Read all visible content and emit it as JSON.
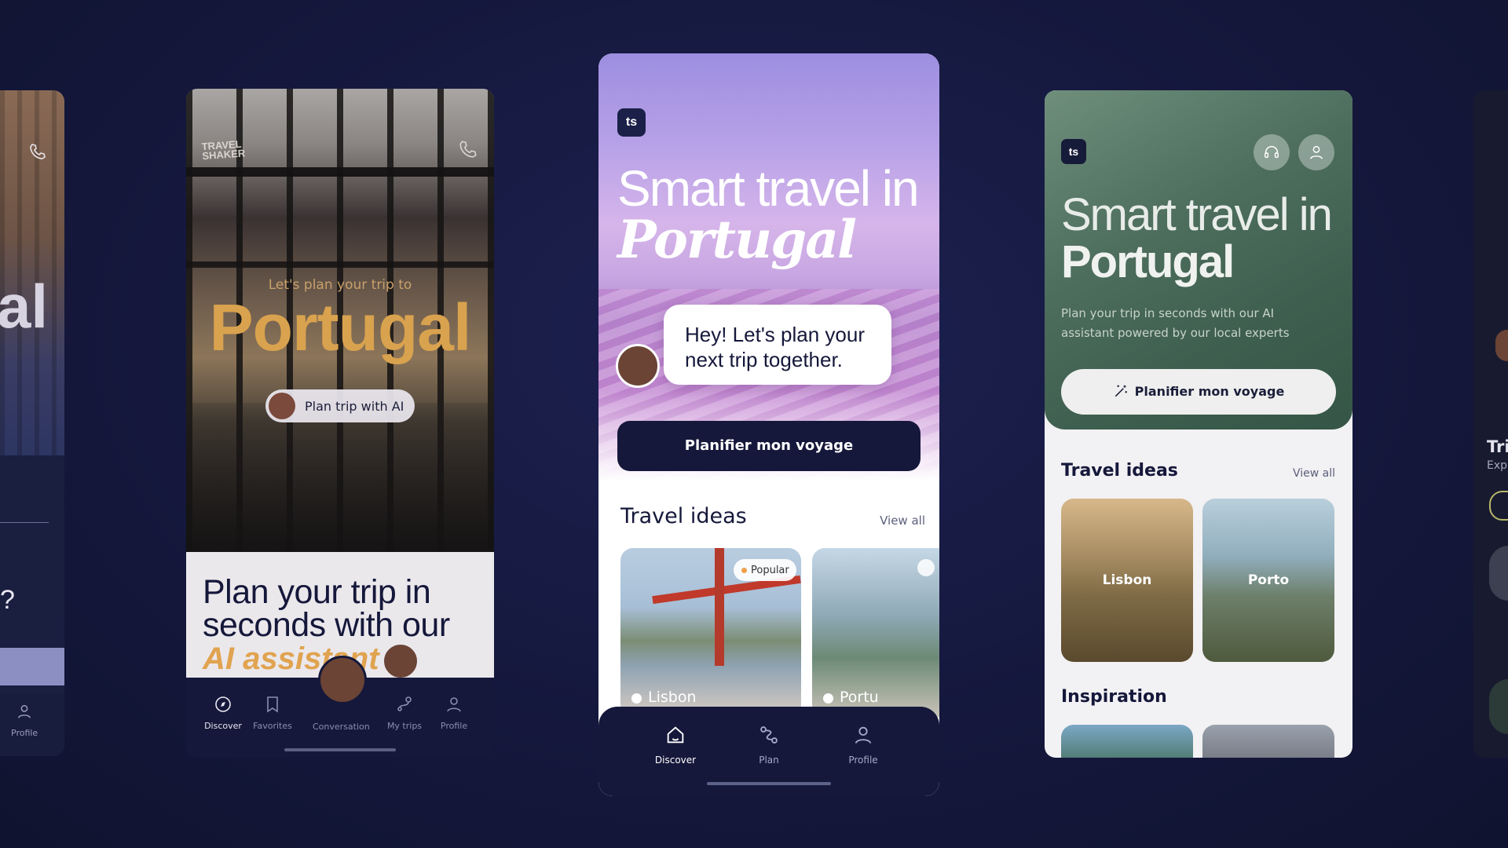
{
  "colors": {
    "background": "#15183d",
    "navy": "#15183a",
    "gold_accent": "#d9a24e",
    "lavender": "#b8a2e8",
    "sage_green": "#4d6d5d"
  },
  "left_partial": {
    "title_fragment": "al",
    "question_fragment": "?",
    "nav_profile": "Profile",
    "icons": [
      "phone-icon",
      "profile-icon"
    ]
  },
  "screen_dark": {
    "logo_text": "TRAVEL SHAKER",
    "kicker": "Let's plan your trip to",
    "title": "Portugal",
    "cta": "Plan trip with AI",
    "headline": "Plan your trip in seconds with our",
    "headline_accent": "AI assistant",
    "nav": [
      {
        "label": "Discover",
        "icon": "compass-icon",
        "active": true
      },
      {
        "label": "Favorites",
        "icon": "bookmark-icon",
        "active": false
      },
      {
        "label": "Conversation",
        "icon": "avatar",
        "active": false
      },
      {
        "label": "My trips",
        "icon": "route-icon",
        "active": false
      },
      {
        "label": "Profile",
        "icon": "profile-icon",
        "active": false
      }
    ]
  },
  "screen_lavender": {
    "logo": "ts",
    "title_line1": "Smart travel in",
    "title_line2": "Portugal",
    "bubble": "Hey! Let's plan your next trip together.",
    "cta": "Planifier mon voyage",
    "section_title": "Travel ideas",
    "view_all": "View all",
    "ideas": [
      {
        "label": "Lisbon",
        "badge": "Popular"
      },
      {
        "label": "Portu",
        "badge": ""
      }
    ],
    "nav": [
      {
        "label": "Discover",
        "icon": "home-icon",
        "active": true
      },
      {
        "label": "Plan",
        "icon": "route-icon",
        "active": false
      },
      {
        "label": "Profile",
        "icon": "profile-icon",
        "active": false
      }
    ]
  },
  "screen_green": {
    "logo": "ts",
    "title_line1": "Smart travel in",
    "title_line2": "Portugal",
    "subtitle": "Plan your trip in seconds with our AI assistant powered by our local experts",
    "cta": "Planifier mon voyage",
    "section_title": "Travel ideas",
    "view_all": "View all",
    "ideas": [
      {
        "label": "Lisbon"
      },
      {
        "label": "Porto"
      }
    ],
    "inspiration": "Inspiration",
    "header_icons": [
      "headset-icon",
      "profile-icon"
    ]
  },
  "right_partial": {
    "title_fragment": "Tri",
    "sub_fragment": "Exp"
  }
}
